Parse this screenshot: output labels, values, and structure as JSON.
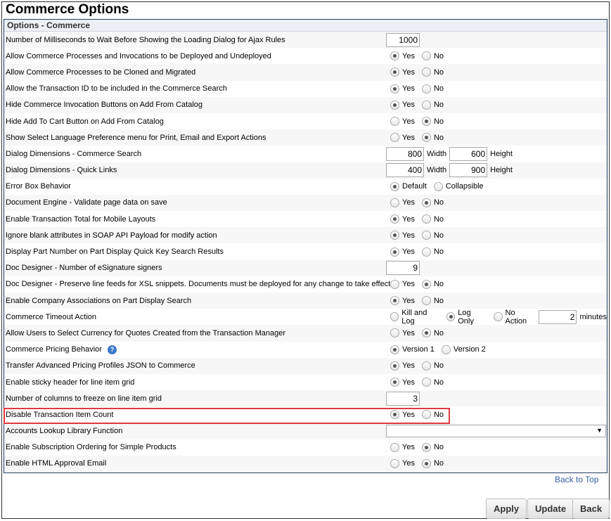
{
  "title": "Commerce Options",
  "section": "Options - Commerce",
  "rows": [
    {
      "label": "Number of Milliseconds to Wait Before Showing the Loading Dialog for Ajax Rules",
      "type": "text",
      "value": "1000"
    },
    {
      "label": "Allow Commerce Processes and Invocations to be Deployed and Undeployed",
      "type": "radio",
      "options": [
        "Yes",
        "No"
      ],
      "selected": 0
    },
    {
      "label": "Allow Commerce Processes to be Cloned and Migrated",
      "type": "radio",
      "options": [
        "Yes",
        "No"
      ],
      "selected": 0
    },
    {
      "label": "Allow the Transaction ID to be included in the Commerce Search",
      "type": "radio",
      "options": [
        "Yes",
        "No"
      ],
      "selected": 0
    },
    {
      "label": "Hide Commerce Invocation Buttons on Add From Catalog",
      "type": "radio",
      "options": [
        "Yes",
        "No"
      ],
      "selected": 0
    },
    {
      "label": "Hide Add To Cart Button on Add From Catalog",
      "type": "radio",
      "options": [
        "Yes",
        "No"
      ],
      "selected": 1
    },
    {
      "label": "Show Select Language Preference menu for Print, Email and Export Actions",
      "type": "radio",
      "options": [
        "Yes",
        "No"
      ],
      "selected": 1
    },
    {
      "label": "Dialog Dimensions - Commerce Search",
      "type": "dims",
      "width": "800",
      "height": "600",
      "width_label": "Width",
      "height_label": "Height"
    },
    {
      "label": "Dialog Dimensions - Quick Links",
      "type": "dims",
      "width": "400",
      "height": "900",
      "width_label": "Width",
      "height_label": "Height"
    },
    {
      "label": "Error Box Behavior",
      "type": "radio",
      "options": [
        "Default",
        "Collapsible"
      ],
      "selected": 0
    },
    {
      "label": "Document Engine - Validate page data on save",
      "type": "radio",
      "options": [
        "Yes",
        "No"
      ],
      "selected": 1
    },
    {
      "label": "Enable Transaction Total for Mobile Layouts",
      "type": "radio",
      "options": [
        "Yes",
        "No"
      ],
      "selected": 0
    },
    {
      "label": "Ignore blank attributes in SOAP API Payload for modify action",
      "type": "radio",
      "options": [
        "Yes",
        "No"
      ],
      "selected": 0
    },
    {
      "label": "Display Part Number on Part Display Quick Key Search Results",
      "type": "radio",
      "options": [
        "Yes",
        "No"
      ],
      "selected": 0
    },
    {
      "label": "Doc Designer - Number of eSignature signers",
      "type": "text",
      "value": "9"
    },
    {
      "label": "Doc Designer - Preserve line feeds for XSL snippets. Documents must be deployed for any change to take effect.",
      "type": "radio",
      "options": [
        "Yes",
        "No"
      ],
      "selected": 1
    },
    {
      "label": "Enable Company Associations on Part Display Search",
      "type": "radio",
      "options": [
        "Yes",
        "No"
      ],
      "selected": 0
    },
    {
      "label": "Commerce Timeout Action",
      "type": "timeout",
      "options": [
        "Kill and Log",
        "Log Only",
        "No Action"
      ],
      "selected": 1,
      "value": "2",
      "unit": "minutes"
    },
    {
      "label": "Allow Users to Select Currency for Quotes Created from the Transaction Manager",
      "type": "radio",
      "options": [
        "Yes",
        "No"
      ],
      "selected": 1
    },
    {
      "label": "Commerce Pricing Behavior",
      "type": "radio",
      "help": true,
      "options": [
        "Version 1",
        "Version 2"
      ],
      "selected": 0
    },
    {
      "label": "Transfer Advanced Pricing Profiles JSON to Commerce",
      "type": "radio",
      "options": [
        "Yes",
        "No"
      ],
      "selected": 0
    },
    {
      "label": "Enable sticky header for line item grid",
      "type": "radio",
      "options": [
        "Yes",
        "No"
      ],
      "selected": 0
    },
    {
      "label": "Number of columns to freeze on line item grid",
      "type": "text",
      "value": "3"
    },
    {
      "label": "Disable Transaction Item Count",
      "type": "radio",
      "options": [
        "Yes",
        "No"
      ],
      "selected": 0
    },
    {
      "label": "Accounts Lookup Library Function",
      "type": "select",
      "value": ""
    },
    {
      "label": "Enable Subscription Ordering for Simple Products",
      "type": "radio",
      "options": [
        "Yes",
        "No"
      ],
      "selected": 1
    },
    {
      "label": "Enable HTML Approval Email",
      "type": "radio",
      "options": [
        "Yes",
        "No"
      ],
      "selected": 1
    }
  ],
  "help_icon": "?",
  "back_to_top": "Back to Top",
  "buttons": {
    "apply": "Apply",
    "update": "Update",
    "back": "Back"
  },
  "highlight_color": "#e0393e"
}
